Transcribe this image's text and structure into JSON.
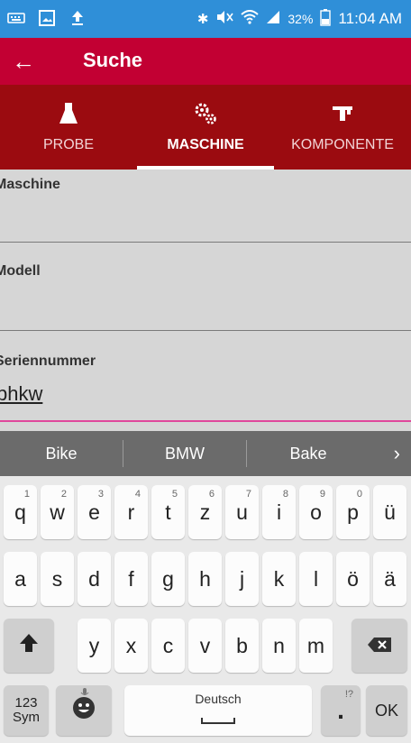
{
  "status_bar": {
    "battery": "32%",
    "time": "11:04 AM"
  },
  "app_bar": {
    "title": "Suche"
  },
  "tabs": [
    {
      "label": "PROBE",
      "icon": "flask-icon",
      "active": false
    },
    {
      "label": "MASCHINE",
      "icon": "gears-icon",
      "active": true
    },
    {
      "label": "KOMPONENTE",
      "icon": "component-icon",
      "active": false
    }
  ],
  "form": {
    "maschine": {
      "label": "Maschine",
      "value": ""
    },
    "modell": {
      "label": "Modell",
      "value": ""
    },
    "seriennummer": {
      "label": "Seriennummer",
      "value": "bhkw"
    }
  },
  "keyboard": {
    "suggestions": [
      "Bike",
      "BMW",
      "Bake"
    ],
    "row1": [
      {
        "k": "q",
        "n": "1"
      },
      {
        "k": "w",
        "n": "2"
      },
      {
        "k": "e",
        "n": "3"
      },
      {
        "k": "r",
        "n": "4"
      },
      {
        "k": "t",
        "n": "5"
      },
      {
        "k": "z",
        "n": "6"
      },
      {
        "k": "u",
        "n": "7"
      },
      {
        "k": "i",
        "n": "8"
      },
      {
        "k": "o",
        "n": "9"
      },
      {
        "k": "p",
        "n": "0"
      },
      {
        "k": "ü",
        "n": ""
      }
    ],
    "row2": [
      "a",
      "s",
      "d",
      "f",
      "g",
      "h",
      "j",
      "k",
      "l",
      "ö",
      "ä"
    ],
    "row3": [
      "y",
      "x",
      "c",
      "v",
      "b",
      "n",
      "m"
    ],
    "sym_label_1": "123",
    "sym_label_2": "Sym",
    "space_label": "Deutsch",
    "dot_label": ".",
    "dot_hint": "!?",
    "ok_label": "OK"
  },
  "colors": {
    "status_bar": "#2f8fd8",
    "app_bar": "#c20033",
    "tab_bar": "#9b0b10",
    "accent_underline": "#e0479c"
  }
}
